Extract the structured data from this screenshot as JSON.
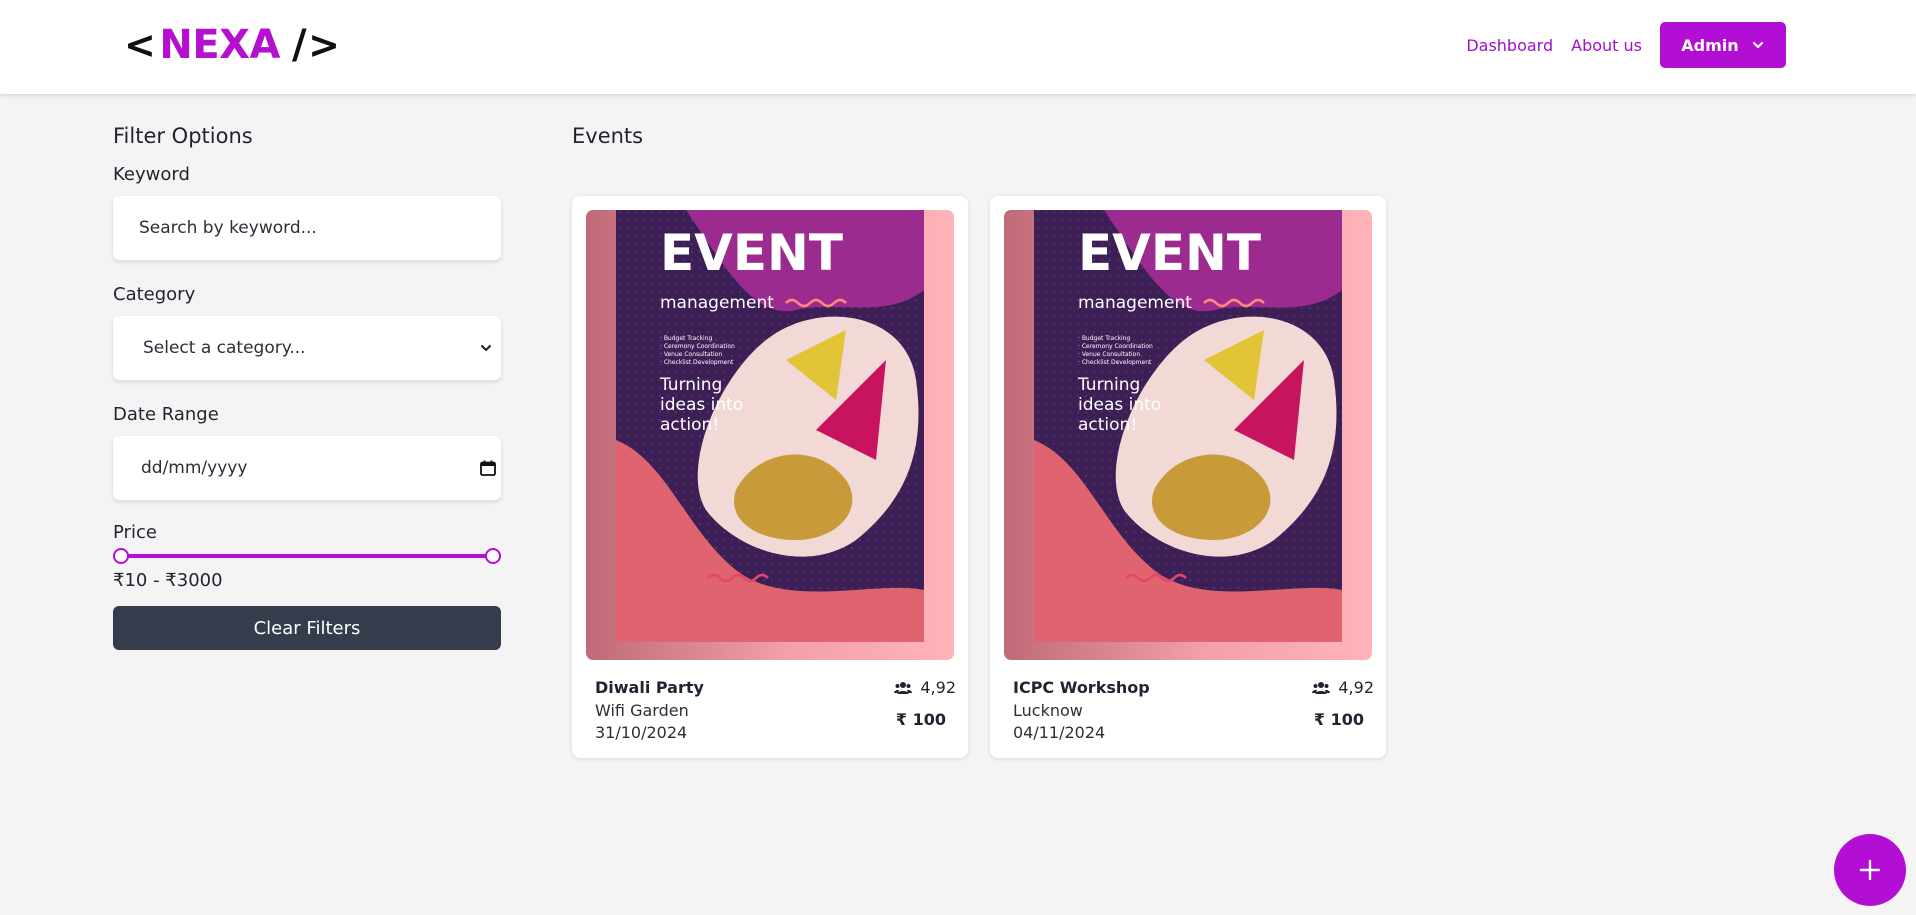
{
  "header": {
    "logo": {
      "open": "<",
      "name": "NEXA",
      "slash": "/",
      "close": ">"
    },
    "nav": {
      "dashboard": "Dashboard",
      "about": "About us",
      "admin": "Admin"
    }
  },
  "filters": {
    "title": "Filter Options",
    "keyword_label": "Keyword",
    "keyword_placeholder": "Search by keyword...",
    "category_label": "Category",
    "category_selected": "Select a category...",
    "date_label": "Date Range",
    "date_placeholder": "dd/mm/yyyy",
    "price_label": "Price",
    "price_range": "₹10 - ₹3000",
    "price_min_fraction": 0,
    "price_max_fraction": 1,
    "clear_label": "Clear Filters"
  },
  "events": {
    "title": "Events",
    "poster": {
      "headline": "EVENT",
      "subheadline": "management",
      "bullets": [
        "· Budget Tracking",
        "· Ceremony Coordination",
        "· Venue Consultation",
        "· Checklist Development"
      ],
      "tagline_lines": [
        "Turning",
        "ideas into",
        "action!"
      ]
    },
    "items": [
      {
        "name": "Diwali Party",
        "location": "Wifi Garden",
        "date": "31/10/2024",
        "attendees": "4,92",
        "price": "₹ 100"
      },
      {
        "name": "ICPC Workshop",
        "location": "Lucknow",
        "date": "04/11/2024",
        "attendees": "4,92",
        "price": "₹ 100"
      }
    ]
  },
  "colors": {
    "brand": "#b30ed4",
    "dark_button": "#353c4c",
    "background": "#f4f4f4"
  },
  "icons": {
    "admin_dropdown": "chevron-down-icon",
    "attendees": "users-icon",
    "calendar": "calendar-icon",
    "add": "plus-icon"
  }
}
